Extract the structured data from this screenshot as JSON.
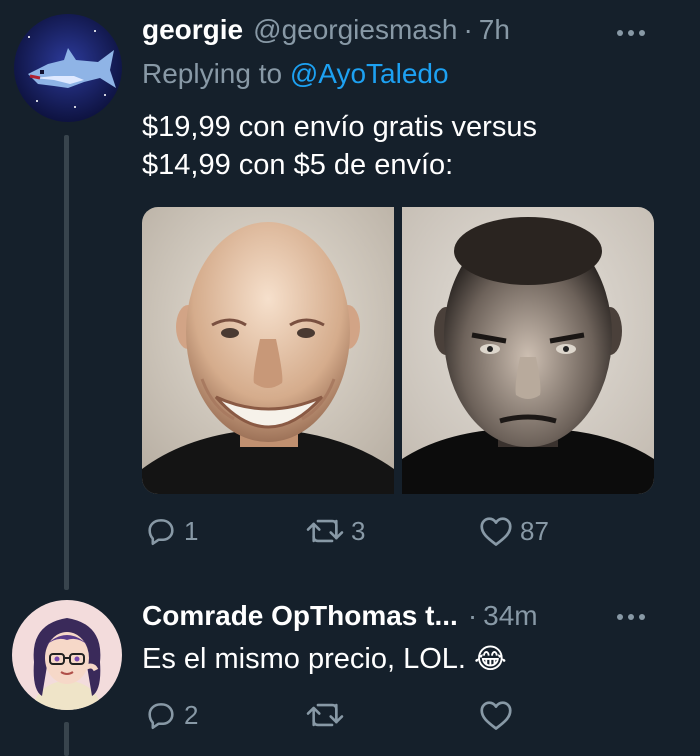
{
  "tweet1": {
    "display_name": "georgie",
    "handle": "@georgiesmash",
    "separator": "·",
    "time": "7h",
    "replying_prefix": "Replying to",
    "replying_handle": "@AyoTaledo",
    "text_line1": "$19,99 con envío gratis versus",
    "text_line2": "$14,99 con $5 de envío:",
    "reply_count": "1",
    "retweet_count": "3",
    "like_count": "87"
  },
  "tweet2": {
    "display_name": "Comrade OpThomas t...",
    "separator": "·",
    "time": "34m",
    "text": "Es el mismo precio, LOL.",
    "emoji": "😂",
    "reply_count": "2"
  },
  "icons": [
    "more-icon",
    "reply-icon",
    "retweet-icon",
    "like-icon"
  ],
  "colors": {
    "background": "#15202b",
    "muted_text": "#8899a6",
    "link": "#1da1f2",
    "thread_line": "#38444d"
  }
}
